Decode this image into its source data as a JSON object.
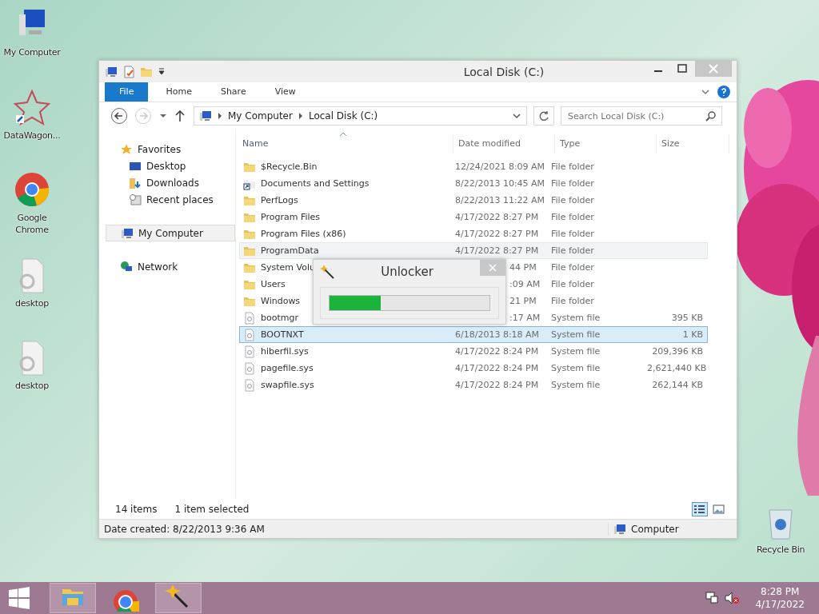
{
  "desktop_icons": [
    {
      "label": "My Computer",
      "kind": "computer"
    },
    {
      "label": "DataWagon...",
      "kind": "star"
    },
    {
      "label": "Google Chrome",
      "kind": "chrome"
    },
    {
      "label": "desktop",
      "kind": "settings"
    },
    {
      "label": "desktop",
      "kind": "settings"
    },
    {
      "label": "Recycle Bin",
      "kind": "bin"
    }
  ],
  "window": {
    "title": "Local Disk (C:)",
    "ribbon_tabs": [
      {
        "label": "File",
        "selected": true
      },
      {
        "label": "Home",
        "selected": false
      },
      {
        "label": "Share",
        "selected": false
      },
      {
        "label": "View",
        "selected": false
      }
    ],
    "breadcrumb": [
      "My Computer",
      "Local Disk (C:)"
    ],
    "search": {
      "placeholder": "Search Local Disk (C:)"
    },
    "sidebar": [
      {
        "label": "Favorites",
        "kind": "star",
        "selected": false,
        "children": [
          {
            "label": "Desktop",
            "kind": "desktop",
            "selected": false
          },
          {
            "label": "Downloads",
            "kind": "downloads",
            "selected": false
          },
          {
            "label": "Recent places",
            "kind": "recent",
            "selected": false
          }
        ]
      },
      {
        "label": "My Computer",
        "kind": "computer",
        "selected": true
      },
      {
        "label": "Network",
        "kind": "network",
        "selected": false
      }
    ],
    "columns": [
      "Name",
      "Date modified",
      "Type",
      "Size"
    ],
    "rows": [
      {
        "name": "$Recycle.Bin",
        "date": "12/24/2021 8:09 AM",
        "type": "File folder",
        "kind": "folder",
        "selected": false,
        "hovered": false
      },
      {
        "name": "Documents and Settings",
        "date": "8/22/2013 10:45 AM",
        "type": "File folder",
        "kind": "shortcut",
        "selected": false,
        "hovered": false
      },
      {
        "name": "PerfLogs",
        "date": "8/22/2013 11:22 AM",
        "type": "File folder",
        "kind": "folder",
        "selected": false,
        "hovered": false
      },
      {
        "name": "Program Files",
        "date": "4/17/2022 8:27 PM",
        "type": "File folder",
        "kind": "folder",
        "selected": false,
        "hovered": false
      },
      {
        "name": "Program Files (x86)",
        "date": "4/17/2022 8:27 PM",
        "type": "File folder",
        "kind": "folder",
        "selected": false,
        "hovered": false
      },
      {
        "name": "ProgramData",
        "date": "4/17/2022 8:27 PM",
        "type": "File folder",
        "kind": "folder",
        "selected": false,
        "hovered": true
      },
      {
        "name": "System Volu",
        "date": "44 PM",
        "type": "File folder",
        "kind": "folder",
        "selected": false,
        "hovered": false,
        "date_partial": true
      },
      {
        "name": "Users",
        "date": ":09 AM",
        "type": "File folder",
        "kind": "folder",
        "selected": false,
        "hovered": false,
        "date_partial": true
      },
      {
        "name": "Windows",
        "date": "21 PM",
        "type": "File folder",
        "kind": "folder",
        "selected": false,
        "hovered": false,
        "date_partial": true
      },
      {
        "name": "bootmgr",
        "date": ":17 AM",
        "type": "System file",
        "size": "395 KB",
        "kind": "system",
        "selected": false,
        "hovered": false,
        "date_partial": true
      },
      {
        "name": "BOOTNXT",
        "date": "6/18/2013 8:18 AM",
        "type": "System file",
        "size": "1 KB",
        "kind": "system",
        "selected": true,
        "hovered": false
      },
      {
        "name": "hiberfil.sys",
        "date": "4/17/2022 8:24 PM",
        "type": "System file",
        "size": "209,396 KB",
        "kind": "system",
        "selected": false,
        "hovered": false
      },
      {
        "name": "pagefile.sys",
        "date": "4/17/2022 8:24 PM",
        "type": "System file",
        "size": "2,621,440 KB",
        "kind": "system",
        "selected": false,
        "hovered": false
      },
      {
        "name": "swapfile.sys",
        "date": "4/17/2022 8:24 PM",
        "type": "System file",
        "size": "262,144 KB",
        "kind": "system",
        "selected": false,
        "hovered": false
      }
    ],
    "status": {
      "count": "14 items",
      "selection": "1 item selected",
      "views": [
        {
          "kind": "details",
          "selected": true
        },
        {
          "kind": "thumbnails",
          "selected": false
        }
      ]
    },
    "details": {
      "text": "Date created: 8/22/2013 9:36 AM",
      "location": "Computer"
    }
  },
  "dialog": {
    "title": "Unlocker",
    "level": 0.32
  },
  "taskbar": {
    "items": [
      {
        "kind": "explorer",
        "selected": true
      },
      {
        "kind": "chrome",
        "selected": false
      },
      {
        "kind": "wand",
        "selected": true
      }
    ],
    "time": "8:28 PM",
    "date": "4/17/2022"
  }
}
